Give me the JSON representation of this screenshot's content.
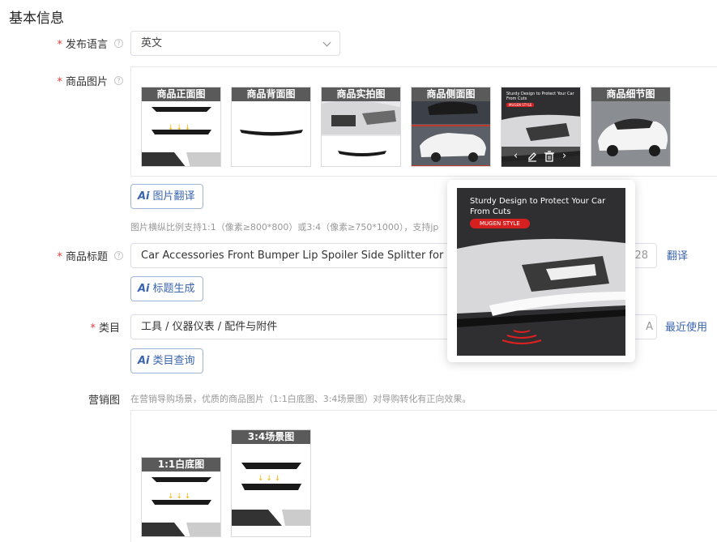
{
  "section_title": "基本信息",
  "fields": {
    "language": {
      "label": "发布语言",
      "value": "英文"
    },
    "images": {
      "label": "商品图片",
      "thumbs": [
        {
          "label": "商品正面图"
        },
        {
          "label": "商品背面图"
        },
        {
          "label": "商品实拍图"
        },
        {
          "label": "商品侧面图"
        },
        {
          "label": ""
        },
        {
          "label": "商品细节图"
        }
      ],
      "thumb5_caption": "Sturdy Design to Protect Your Car From Cuts",
      "thumb5_brand": "MUGEN STYLE",
      "translate_button": "图片翻译",
      "hint": "图片横纵比例支持1:1（像素≥800*800）或3:4（像素≥750*1000），支持jp"
    },
    "title": {
      "label": "商品标题",
      "value": "Car Accessories Front Bumper Lip Spoiler Side Splitter for Civi",
      "counter": "28",
      "translate_link": "翻译",
      "generate_button": "标题生成"
    },
    "category": {
      "label": "类目",
      "value": "工具 / 仪器仪表 / 配件与附件",
      "edge_char": "A",
      "recent_link": "最近使用",
      "query_button": "类目查询"
    },
    "marketing": {
      "label": "营销图",
      "hint": "在营销导购场景，优质的商品图片（1:1白底图、3:4场景图）对导购转化有正向效果。",
      "images": [
        {
          "label": "1:1白底图"
        },
        {
          "label": "3:4场景图"
        }
      ]
    }
  },
  "popover": {
    "caption": "Sturdy Design to Protect Your Car From Cuts",
    "brand": "MUGEN STYLE"
  },
  "hover_toolbar": {
    "prev": "‹",
    "next": "›"
  },
  "colors": {
    "accent": "#3a64ad",
    "required": "#e4393c",
    "thumb_label_bg": "#5a5a5a"
  }
}
